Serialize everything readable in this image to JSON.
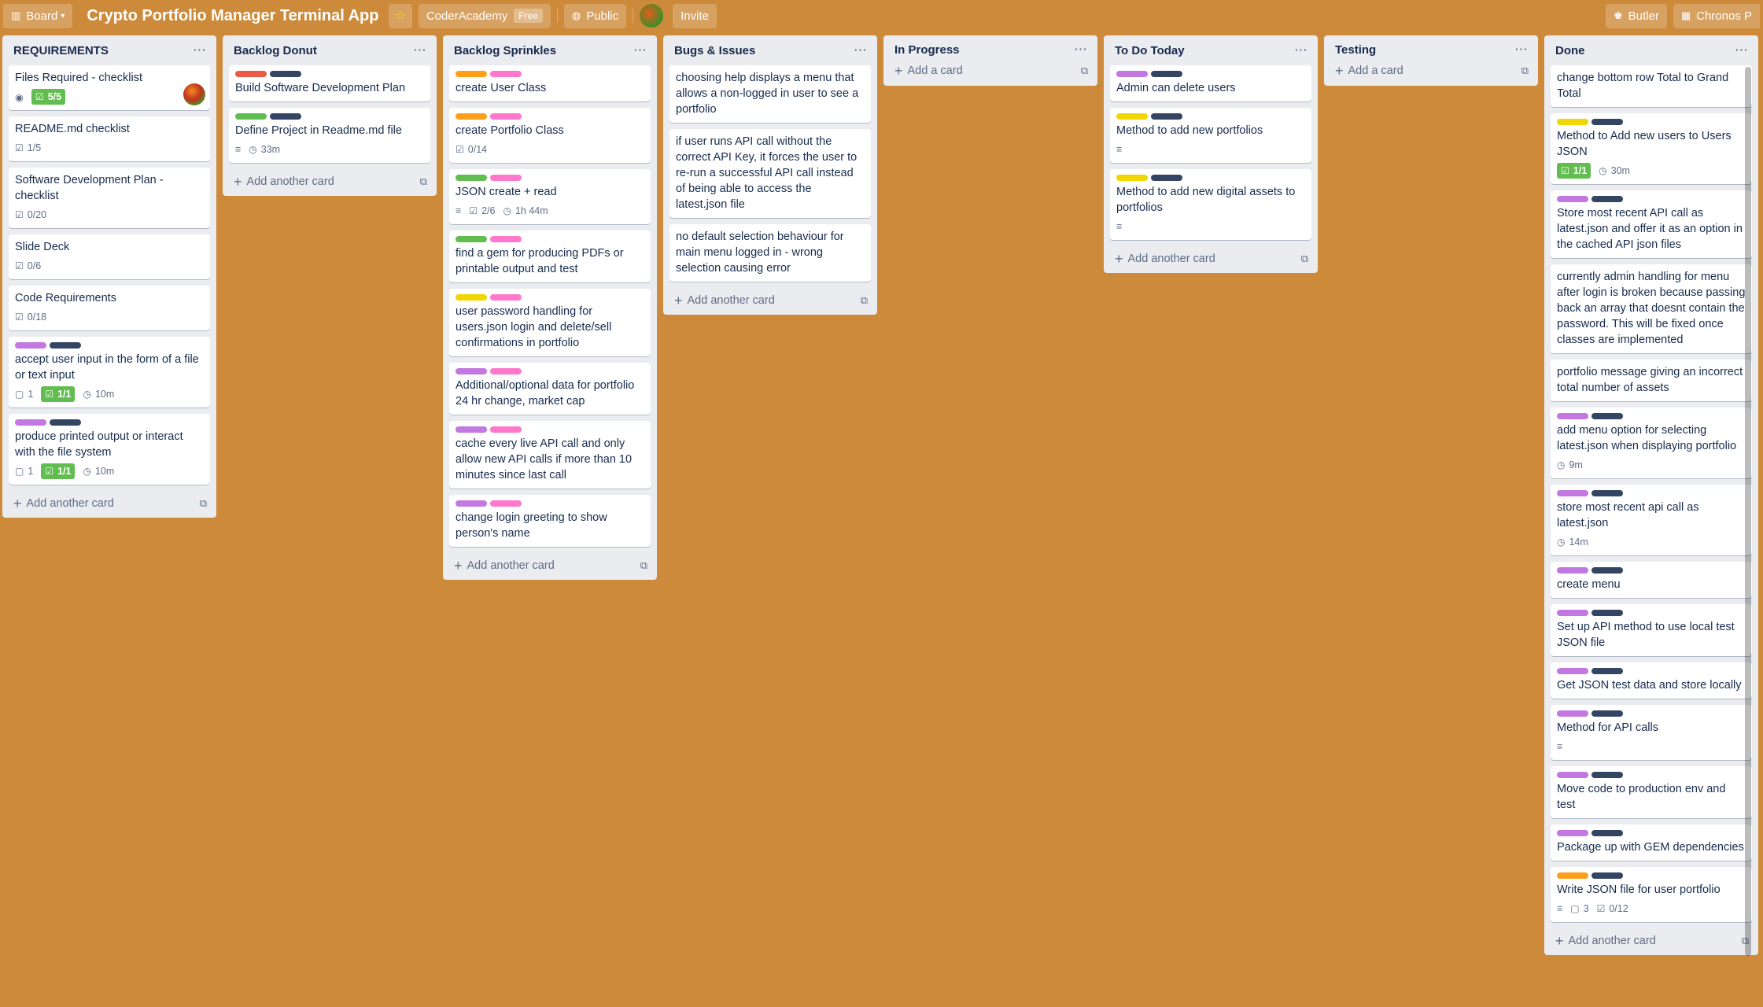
{
  "header": {
    "board_view": "Board",
    "title": "Crypto Portfolio Manager Terminal App",
    "team": "CoderAcademy",
    "team_plan": "Free",
    "visibility": "Public",
    "invite": "Invite",
    "butler": "Butler",
    "chronos": "Chronos P"
  },
  "colors": {
    "background": "#cd8a3a",
    "green": "#61bd4f",
    "yellow": "#f2d600",
    "orange": "#ff9f1a",
    "red": "#eb5a46",
    "purple": "#c377e0",
    "pink": "#ff78cb",
    "navy": "#344563"
  },
  "lists": [
    {
      "title": "REQUIREMENTS",
      "footer": "Add another card",
      "cards": [
        {
          "title": "Files Required - checklist",
          "watch": true,
          "checklist": "5/5",
          "done": true,
          "avatar": true
        },
        {
          "title": "README.md checklist",
          "checklist": "1/5"
        },
        {
          "title": "Software Development Plan - checklist",
          "checklist": "0/20"
        },
        {
          "title": "Slide Deck",
          "checklist": "0/6"
        },
        {
          "title": "Code Requirements",
          "checklist": "0/18"
        },
        {
          "labels": [
            "purple",
            "navy"
          ],
          "title": "accept user input in the form of a file or text input",
          "comments": "1",
          "checklist": "1/1",
          "done": true,
          "time": "10m"
        },
        {
          "labels": [
            "purple",
            "navy"
          ],
          "title": "produce printed output or interact with the file system",
          "comments": "1",
          "checklist": "1/1",
          "done": true,
          "time": "10m"
        }
      ]
    },
    {
      "title": "Backlog Donut",
      "footer": "Add another card",
      "cards": [
        {
          "labels": [
            "red",
            "navy"
          ],
          "title": "Build Software Development Plan"
        },
        {
          "labels": [
            "green",
            "navy"
          ],
          "title": "Define Project in Readme.md file",
          "desc": true,
          "time": "33m"
        }
      ]
    },
    {
      "title": "Backlog Sprinkles",
      "footer": "Add another card",
      "cards": [
        {
          "labels": [
            "orange",
            "pink"
          ],
          "title": "create User Class"
        },
        {
          "labels": [
            "orange",
            "pink"
          ],
          "title": "create Portfolio Class",
          "checklist": "0/14"
        },
        {
          "labels": [
            "green",
            "pink"
          ],
          "title": "JSON create + read",
          "desc": true,
          "checklist": "2/6",
          "time": "1h 44m"
        },
        {
          "labels": [
            "green",
            "pink"
          ],
          "title": "find a gem for producing PDFs or printable output and test"
        },
        {
          "labels": [
            "yellow",
            "pink"
          ],
          "title": "user password handling for users.json login and delete/sell confirmations in portfolio"
        },
        {
          "labels": [
            "purple",
            "pink"
          ],
          "title": "Additional/optional data for portfolio 24 hr change, market cap"
        },
        {
          "labels": [
            "purple",
            "pink"
          ],
          "title": "cache every live API call and only allow new API calls if more than 10 minutes since last call"
        },
        {
          "labels": [
            "purple",
            "pink"
          ],
          "title": "change login greeting to show person's name"
        }
      ]
    },
    {
      "title": "Bugs & Issues",
      "footer": "Add another card",
      "cards": [
        {
          "title": "choosing help displays a menu that allows a non-logged in user to see a portfolio"
        },
        {
          "title": "if user runs API call without the correct API Key, it forces the user to re-run a successful API call instead of being able to access the latest.json file"
        },
        {
          "title": "no default selection behaviour for main menu logged in - wrong selection causing error"
        }
      ]
    },
    {
      "title": "In Progress",
      "footer": "Add a card",
      "cards": []
    },
    {
      "title": "To Do Today",
      "footer": "Add another card",
      "cards": [
        {
          "labels": [
            "purple",
            "navy"
          ],
          "title": "Admin can delete users"
        },
        {
          "labels": [
            "yellow",
            "navy"
          ],
          "title": "Method to add new portfolios",
          "desc": true
        },
        {
          "labels": [
            "yellow",
            "navy"
          ],
          "title": "Method to add new digital assets to portfolios",
          "desc": true
        }
      ]
    },
    {
      "title": "Testing",
      "footer": "Add a card",
      "cards": []
    },
    {
      "title": "Done",
      "footer": "Add another card",
      "cards": [
        {
          "title": "change bottom row Total to Grand Total"
        },
        {
          "labels": [
            "yellow",
            "navy"
          ],
          "title": "Method to Add new users to Users JSON",
          "checklist": "1/1",
          "done": true,
          "time": "30m"
        },
        {
          "labels": [
            "purple",
            "navy"
          ],
          "title": "Store most recent API call as latest.json and offer it as an option in the cached API json files"
        },
        {
          "title": "currently admin handling for menu after login is broken because passing back an array that doesnt contain the password. This will be fixed once classes are implemented"
        },
        {
          "title": "portfolio message giving an incorrect total number of assets"
        },
        {
          "labels": [
            "purple",
            "navy"
          ],
          "title": "add menu option for selecting latest.json when displaying portfolio",
          "time": "9m"
        },
        {
          "labels": [
            "purple",
            "navy"
          ],
          "title": "store most recent api call as latest.json",
          "time": "14m"
        },
        {
          "labels": [
            "purple",
            "navy"
          ],
          "title": "create menu"
        },
        {
          "labels": [
            "purple",
            "navy"
          ],
          "title": "Set up API method to use local test JSON file"
        },
        {
          "labels": [
            "purple",
            "navy"
          ],
          "title": "Get JSON test data and store locally"
        },
        {
          "labels": [
            "purple",
            "navy"
          ],
          "title": "Method for API calls",
          "desc": true
        },
        {
          "labels": [
            "purple",
            "navy"
          ],
          "title": "Move code to production env and test"
        },
        {
          "labels": [
            "purple",
            "navy"
          ],
          "title": "Package up with GEM dependencies"
        },
        {
          "labels": [
            "orange",
            "navy"
          ],
          "title": "Write JSON file for user portfolio",
          "desc": true,
          "comments": "3",
          "checklist": "0/12"
        }
      ]
    }
  ]
}
